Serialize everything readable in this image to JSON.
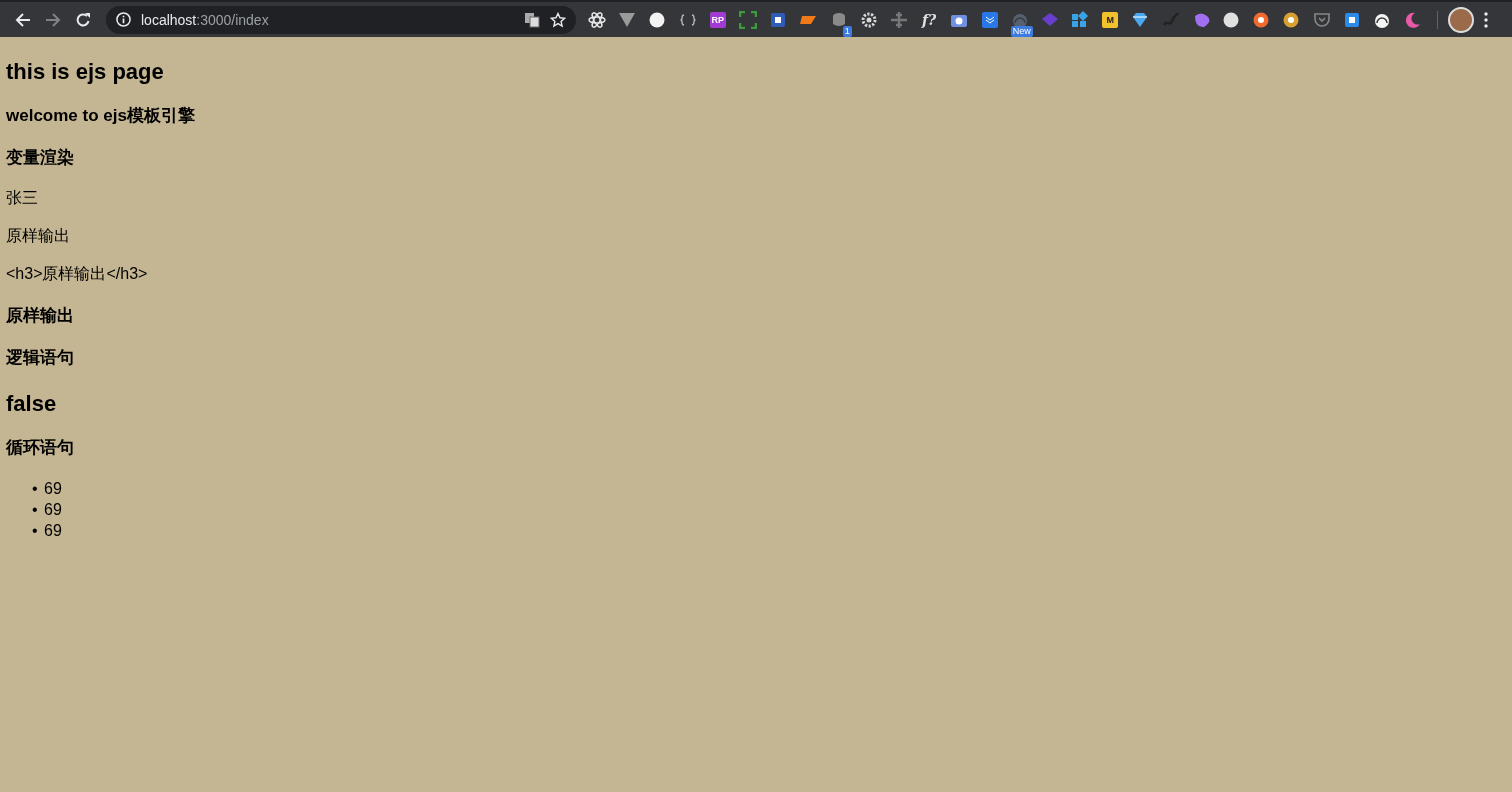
{
  "toolbar": {
    "url_host": "localhost",
    "url_path": ":3000/index",
    "extensions": [
      {
        "kind": "atom",
        "color": "#e8e8e8"
      },
      {
        "kind": "vee",
        "color": "#9a9a9a"
      },
      {
        "kind": "circle",
        "color": "#f2f2f2"
      },
      {
        "kind": "braces",
        "color": "#bbbbbb"
      },
      {
        "kind": "tile",
        "color": "#a23bd1",
        "label": "RP"
      },
      {
        "kind": "corners",
        "color": "#3b9a3b"
      },
      {
        "kind": "square",
        "color": "#2e5db8"
      },
      {
        "kind": "slant",
        "color": "#f07a1a"
      },
      {
        "kind": "coins",
        "color": "#8a8a8a",
        "badge": "1"
      },
      {
        "kind": "gear",
        "color": "#d8d8d8"
      },
      {
        "kind": "cross",
        "color": "#777777"
      },
      {
        "kind": "text",
        "color": "#e0e0e0",
        "label": "f?"
      },
      {
        "kind": "camera",
        "color": "#6f8fe0"
      },
      {
        "kind": "tile",
        "color": "#2a78e8"
      },
      {
        "kind": "gauge",
        "color": "#556070",
        "badge": "New"
      },
      {
        "kind": "diamond",
        "color": "#6a3fd0"
      },
      {
        "kind": "grid",
        "color": "#3aa3e8"
      },
      {
        "kind": "tile",
        "color": "#f2c12e",
        "label": "M"
      },
      {
        "kind": "gem",
        "color": "#4aa8f0"
      },
      {
        "kind": "squiggle",
        "color": "#222222"
      },
      {
        "kind": "blob",
        "color": "#a070f0"
      },
      {
        "kind": "circle",
        "color": "#e0e0e0"
      },
      {
        "kind": "ring",
        "color": "#f06a30"
      },
      {
        "kind": "ring",
        "color": "#d8a030"
      },
      {
        "kind": "pocket",
        "color": "#888888"
      },
      {
        "kind": "square",
        "color": "#2a8ae8"
      },
      {
        "kind": "gauge",
        "color": "#f5f5f5"
      },
      {
        "kind": "moon",
        "color": "#e85aa8"
      }
    ]
  },
  "content": [
    {
      "kind": "h2",
      "text": "this is ejs page"
    },
    {
      "kind": "h3",
      "text": "welcome to ejs模板引擎"
    },
    {
      "kind": "h3",
      "text": "变量渲染"
    },
    {
      "kind": "p",
      "text": "张三"
    },
    {
      "kind": "p",
      "text": "原样输出"
    },
    {
      "kind": "p",
      "text": "<h3>原样输出</h3>"
    },
    {
      "kind": "h3",
      "text": "原样输出"
    },
    {
      "kind": "h3",
      "text": "逻辑语句"
    },
    {
      "kind": "h2",
      "text": "false"
    },
    {
      "kind": "h3",
      "text": "循环语句"
    },
    {
      "kind": "list",
      "items": [
        {
          "marker": "•",
          "text": "69"
        },
        {
          "marker": "•",
          "text": "69"
        },
        {
          "marker": "•",
          "text": "69"
        }
      ]
    }
  ]
}
